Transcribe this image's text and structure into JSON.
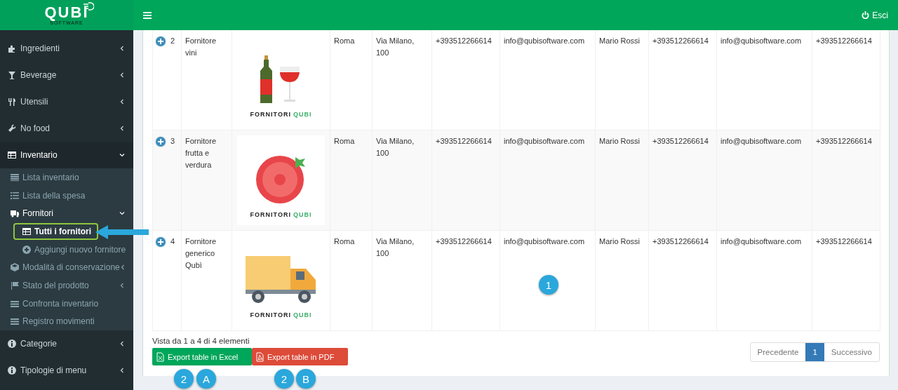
{
  "logo": {
    "name": "QUBI",
    "tagline": "SOFTWARE"
  },
  "header": {
    "logout": "Esci"
  },
  "sidebar": {
    "items": [
      {
        "label": "Ingredienti",
        "selected": false,
        "expanded": false
      },
      {
        "label": "Beverage",
        "selected": false,
        "expanded": false
      },
      {
        "label": "Utensili",
        "selected": false,
        "expanded": false
      },
      {
        "label": "No food",
        "selected": false,
        "expanded": false
      },
      {
        "label": "Inventario",
        "selected": false,
        "expanded": true,
        "children": [
          {
            "label": "Lista inventario",
            "selected": false
          },
          {
            "label": "Lista della spesa",
            "selected": false
          },
          {
            "label": "Fornitori",
            "selected": false,
            "expanded": true,
            "children": [
              {
                "label": "Tutti i fornitori",
                "selected": true
              },
              {
                "label": "Aggiungi nuovo fornitore",
                "selected": false
              }
            ]
          },
          {
            "label": "Modalità di conservazione",
            "selected": false,
            "expanded": false
          },
          {
            "label": "Stato del prodotto",
            "selected": false,
            "expanded": false
          },
          {
            "label": "Confronta inventario",
            "selected": false
          },
          {
            "label": "Registro movimenti",
            "selected": false
          }
        ]
      },
      {
        "label": "Categorie",
        "selected": false,
        "expanded": false
      },
      {
        "label": "Tipologie di menu",
        "selected": false,
        "expanded": false
      }
    ]
  },
  "table": {
    "rows": [
      {
        "number": "2",
        "name": "Fornitore vini",
        "image_caption": [
          "FORNITORI",
          "QUBI"
        ],
        "cells": [
          "Roma",
          "Via Milano, 100",
          "+393512266614",
          "info@qubisoftware.com",
          "Mario Rossi",
          "+393512266614",
          "info@qubisoftware.com",
          "+393512266614"
        ]
      },
      {
        "number": "3",
        "name": "Fornitore frutta e verdura",
        "image_caption": [
          "FORNITORI",
          "QUBI"
        ],
        "cells": [
          "Roma",
          "Via Milano, 100",
          "+393512266614",
          "info@qubisoftware.com",
          "Mario Rossi",
          "+393512266614",
          "info@qubisoftware.com",
          "+393512266614"
        ]
      },
      {
        "number": "4",
        "name": "Fornitore generico Qubì",
        "image_caption": [
          "FORNITORI",
          "QUBI"
        ],
        "cells": [
          "Roma",
          "Via Milano, 100",
          "+393512266614",
          "info@qubisoftware.com",
          "Mario Rossi",
          "+393512266614",
          "info@qubisoftware.com",
          "+393512266614"
        ]
      }
    ]
  },
  "footer": {
    "info": "Vista da 1 a 4 di 4 elementi",
    "export_buttons": [
      {
        "label": "Export table in Excel",
        "kind": "excel"
      },
      {
        "label": "Export table in PDF",
        "kind": "pdf"
      }
    ],
    "pagination": [
      {
        "label": "Precedente",
        "selected": false,
        "disabled": true
      },
      {
        "label": "1",
        "selected": true,
        "disabled": false
      },
      {
        "label": "Successivo",
        "selected": false,
        "disabled": true
      }
    ]
  },
  "annotations": [
    "1",
    "2",
    "A",
    "2",
    "B"
  ]
}
